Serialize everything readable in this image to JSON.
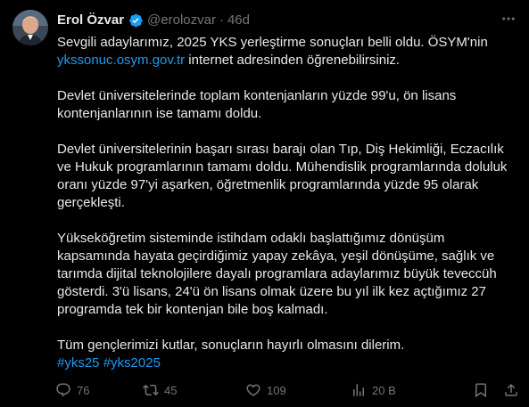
{
  "author": {
    "name": "Erol Özvar",
    "handle": "@erolozvar",
    "separator": "·",
    "time": "46d",
    "verified_color": "#1d9bf0"
  },
  "tweet": {
    "p1_text": "Sevgili adaylarımız, 2025 YKS yerleştirme sonuçları belli oldu. ÖSYM'nin ",
    "p1_link": "ykssonuc.osym.gov.tr",
    "p1_tail": " internet adresinden öğrenebilirsiniz.",
    "p2": "Devlet üniversitelerinde toplam kontenjanların yüzde 99'u, ön lisans kontenjanlarının ise tamamı doldu.",
    "p3": "Devlet üniversitelerinin başarı sırası barajı olan Tıp, Diş Hekimliği, Eczacılık ve Hukuk programlarının tamamı doldu. Mühendislik programlarında doluluk oranı yüzde 97'yi aşarken, öğretmenlik programlarında yüzde 95 olarak gerçekleşti.",
    "p4": "Yükseköğretim sisteminde istihdam odaklı  başlattığımız dönüşüm kapsamında hayata geçirdiğimiz yapay zekâya, yeşil dönüşüme, sağlık ve tarımda dijital teknolojilere dayalı programlara adaylarımız büyük teveccüh gösterdi. 3'ü lisans, 24'ü ön lisans olmak üzere bu yıl ilk kez açtığımız 27 programda tek bir kontenjan bile boş kalmadı.",
    "p5": "Tüm gençlerimizi kutlar, sonuçların hayırlı olmasını dilerim.",
    "hashtags": "#yks25 #yks2025"
  },
  "actions": {
    "replies": "76",
    "reposts": "45",
    "likes": "109",
    "views": "20 B"
  },
  "colors": {
    "background": "#000000",
    "text": "#e7e9ea",
    "muted": "#71767b",
    "link": "#1d9bf0"
  }
}
